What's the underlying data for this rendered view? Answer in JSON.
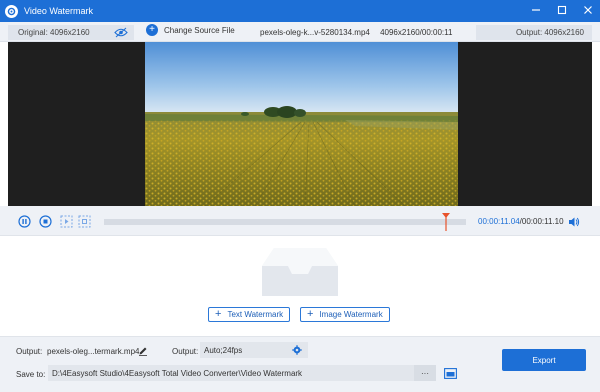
{
  "window": {
    "title": "Video Watermark"
  },
  "infobar": {
    "original_label": "Original: 4096x2160",
    "change_source_label": "Change Source File",
    "file_name": "pexels-oleg-k...v-5280134.mp4",
    "file_meta": "4096x2160/00:00:11",
    "output_label": "Output: 4096x2160"
  },
  "playback": {
    "current_time": "00:00:11.04",
    "separator": "/",
    "total_time": "00:00:11.10",
    "progress_fraction": 0.945
  },
  "watermark": {
    "text_button": "Text Watermark",
    "image_button": "Image Watermark"
  },
  "footer": {
    "output_label": "Output:",
    "output_file": "pexels-oleg...termark.mp4",
    "output_format_label": "Output:",
    "output_format_value": "Auto;24fps",
    "save_to_label": "Save to:",
    "save_path": "D:\\4Easysoft Studio\\4Easysoft Total Video Converter\\Video Watermark",
    "browse_label": "···",
    "export_label": "Export"
  },
  "colors": {
    "accent": "#1d6fd6",
    "playhead": "#e8532c"
  }
}
